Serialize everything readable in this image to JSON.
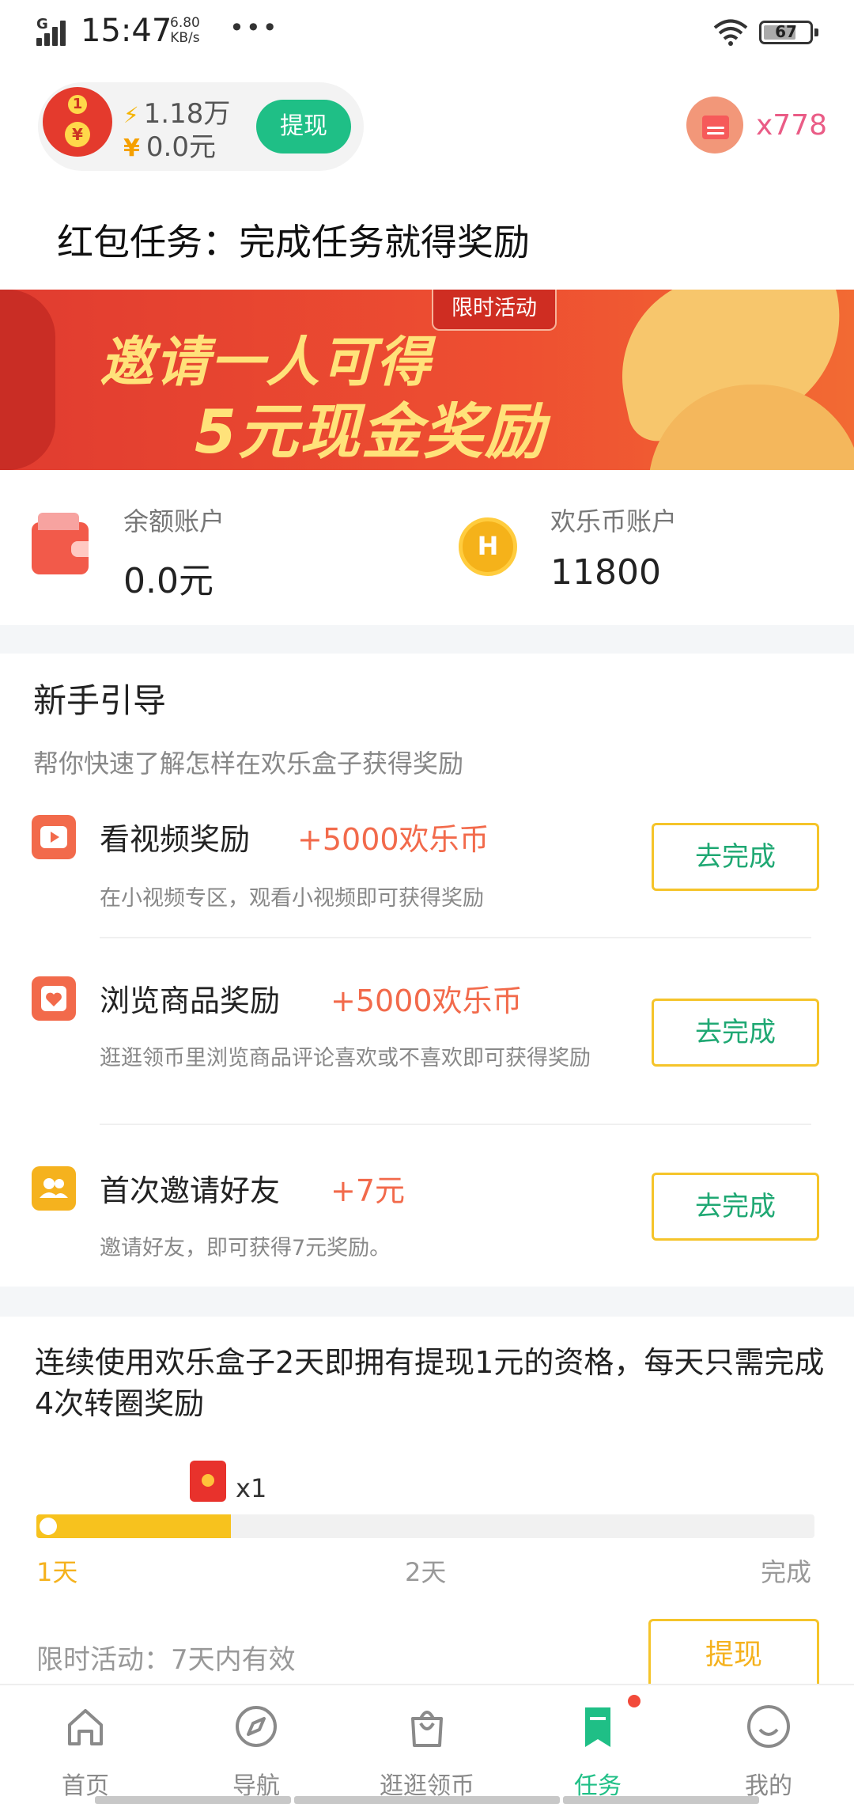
{
  "status_bar": {
    "time": "15:47",
    "network": "G",
    "speed_value": "6.80",
    "speed_unit": "KB/s",
    "more": "•••",
    "battery": "67"
  },
  "header": {
    "coins": "1.18万",
    "cash": "0.0元",
    "cash_symbol": "¥",
    "withdraw_label": "提现",
    "badge_one": "1",
    "coin_yen": "¥",
    "red_pack_count": "x778"
  },
  "page_title": "红包任务：完成任务就得奖励",
  "banner": {
    "tag": "限时活动",
    "line1": "邀请一人可得",
    "line2": "5元现金奖励"
  },
  "accounts": {
    "balance_label": "余额账户",
    "balance_value": "0.0元",
    "coin_label": "欢乐币账户",
    "coin_value": "11800",
    "coin_icon_letter": "H"
  },
  "guide": {
    "title": "新手引导",
    "subtitle": "帮你快速了解怎样在欢乐盒子获得奖励",
    "tasks": [
      {
        "name": "看视频奖励",
        "reward": "+5000欢乐币",
        "desc": "在小视频专区，观看小视频即可获得奖励",
        "button": "去完成",
        "icon": "video-play-icon",
        "color": "#f26a4b"
      },
      {
        "name": "浏览商品奖励",
        "reward": "+5000欢乐币",
        "desc": "逛逛领币里浏览商品评论喜欢或不喜欢即可获得奖励",
        "button": "去完成",
        "icon": "heart-card-icon",
        "color": "#f26a4b"
      },
      {
        "name": "首次邀请好友",
        "reward": "+7元",
        "desc": "邀请好友，即可获得7元奖励。",
        "button": "去完成",
        "icon": "friends-icon",
        "color": "#f5b21e"
      }
    ]
  },
  "continuous": {
    "text": "连续使用欢乐盒子2天即拥有提现1元的资格，每天只需完成4次转圈奖励",
    "reward_multiplier": "x1",
    "progress_fraction": 0.25,
    "days": [
      "1天",
      "2天",
      "完成"
    ],
    "limited_text": "限时活动：7天内有效",
    "withdraw_label": "提现"
  },
  "bottom_nav": [
    {
      "label": "首页",
      "icon": "home-icon"
    },
    {
      "label": "导航",
      "icon": "compass-icon"
    },
    {
      "label": "逛逛领币",
      "icon": "shopping-bag-icon"
    },
    {
      "label": "任务",
      "icon": "bookmark-icon"
    },
    {
      "label": "我的",
      "icon": "smiley-face-icon"
    }
  ],
  "colors": {
    "accent_green": "#1fbf86",
    "accent_yellow": "#f5c42a",
    "reward_red": "#f26a4b",
    "banner_red": "#e13c30"
  }
}
